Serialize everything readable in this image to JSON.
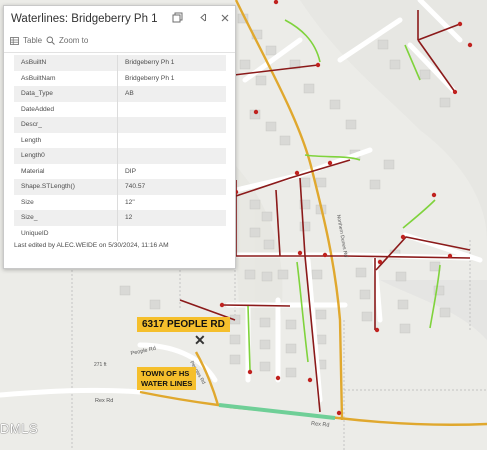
{
  "popup": {
    "title": "Waterlines: Bridgeberry Ph 1",
    "toolbar": {
      "table_label": "Table",
      "zoom_label": "Zoom to"
    },
    "attributes": [
      {
        "key": "AsBuiltN",
        "value": "Bridgeberry Ph 1"
      },
      {
        "key": "AsBuiltNam",
        "value": "Bridgeberry Ph 1"
      },
      {
        "key": "Data_Type",
        "value": "AB"
      },
      {
        "key": "DateAdded",
        "value": ""
      },
      {
        "key": "Descr_",
        "value": ""
      },
      {
        "key": "Length",
        "value": ""
      },
      {
        "key": "Length0",
        "value": ""
      },
      {
        "key": "Material",
        "value": "DIP"
      },
      {
        "key": "Shape.STLength()",
        "value": "740.57"
      },
      {
        "key": "Size",
        "value": "12\""
      },
      {
        "key": "Size_",
        "value": "12"
      },
      {
        "key": "UniqueID",
        "value": ""
      }
    ],
    "edited_text": "Last edited by ALEC.WEIDE on 5/30/2024, 11:16 AM"
  },
  "labels": {
    "address": "6317 PEOPLE RD",
    "town_line1": "TOWN OF HS",
    "town_line2": "WATER LINES",
    "watermark": "DMLS"
  },
  "roads": {
    "peoples_rd": "People Rd",
    "peoples_rd_branch": "Peoples Rd",
    "rex_rd_west": "Rex Rd",
    "rex_rd_east": "Rex Rd",
    "northern_dunes_rd": "Northern Dunes Rd",
    "elevation": "271 ft"
  },
  "colors": {
    "main_road": "#e0a82e",
    "water_line": "#8b1a1a",
    "green_line": "#7fd33c",
    "highlight": "#6fcf97",
    "label_bg": "#f5bf2c"
  }
}
